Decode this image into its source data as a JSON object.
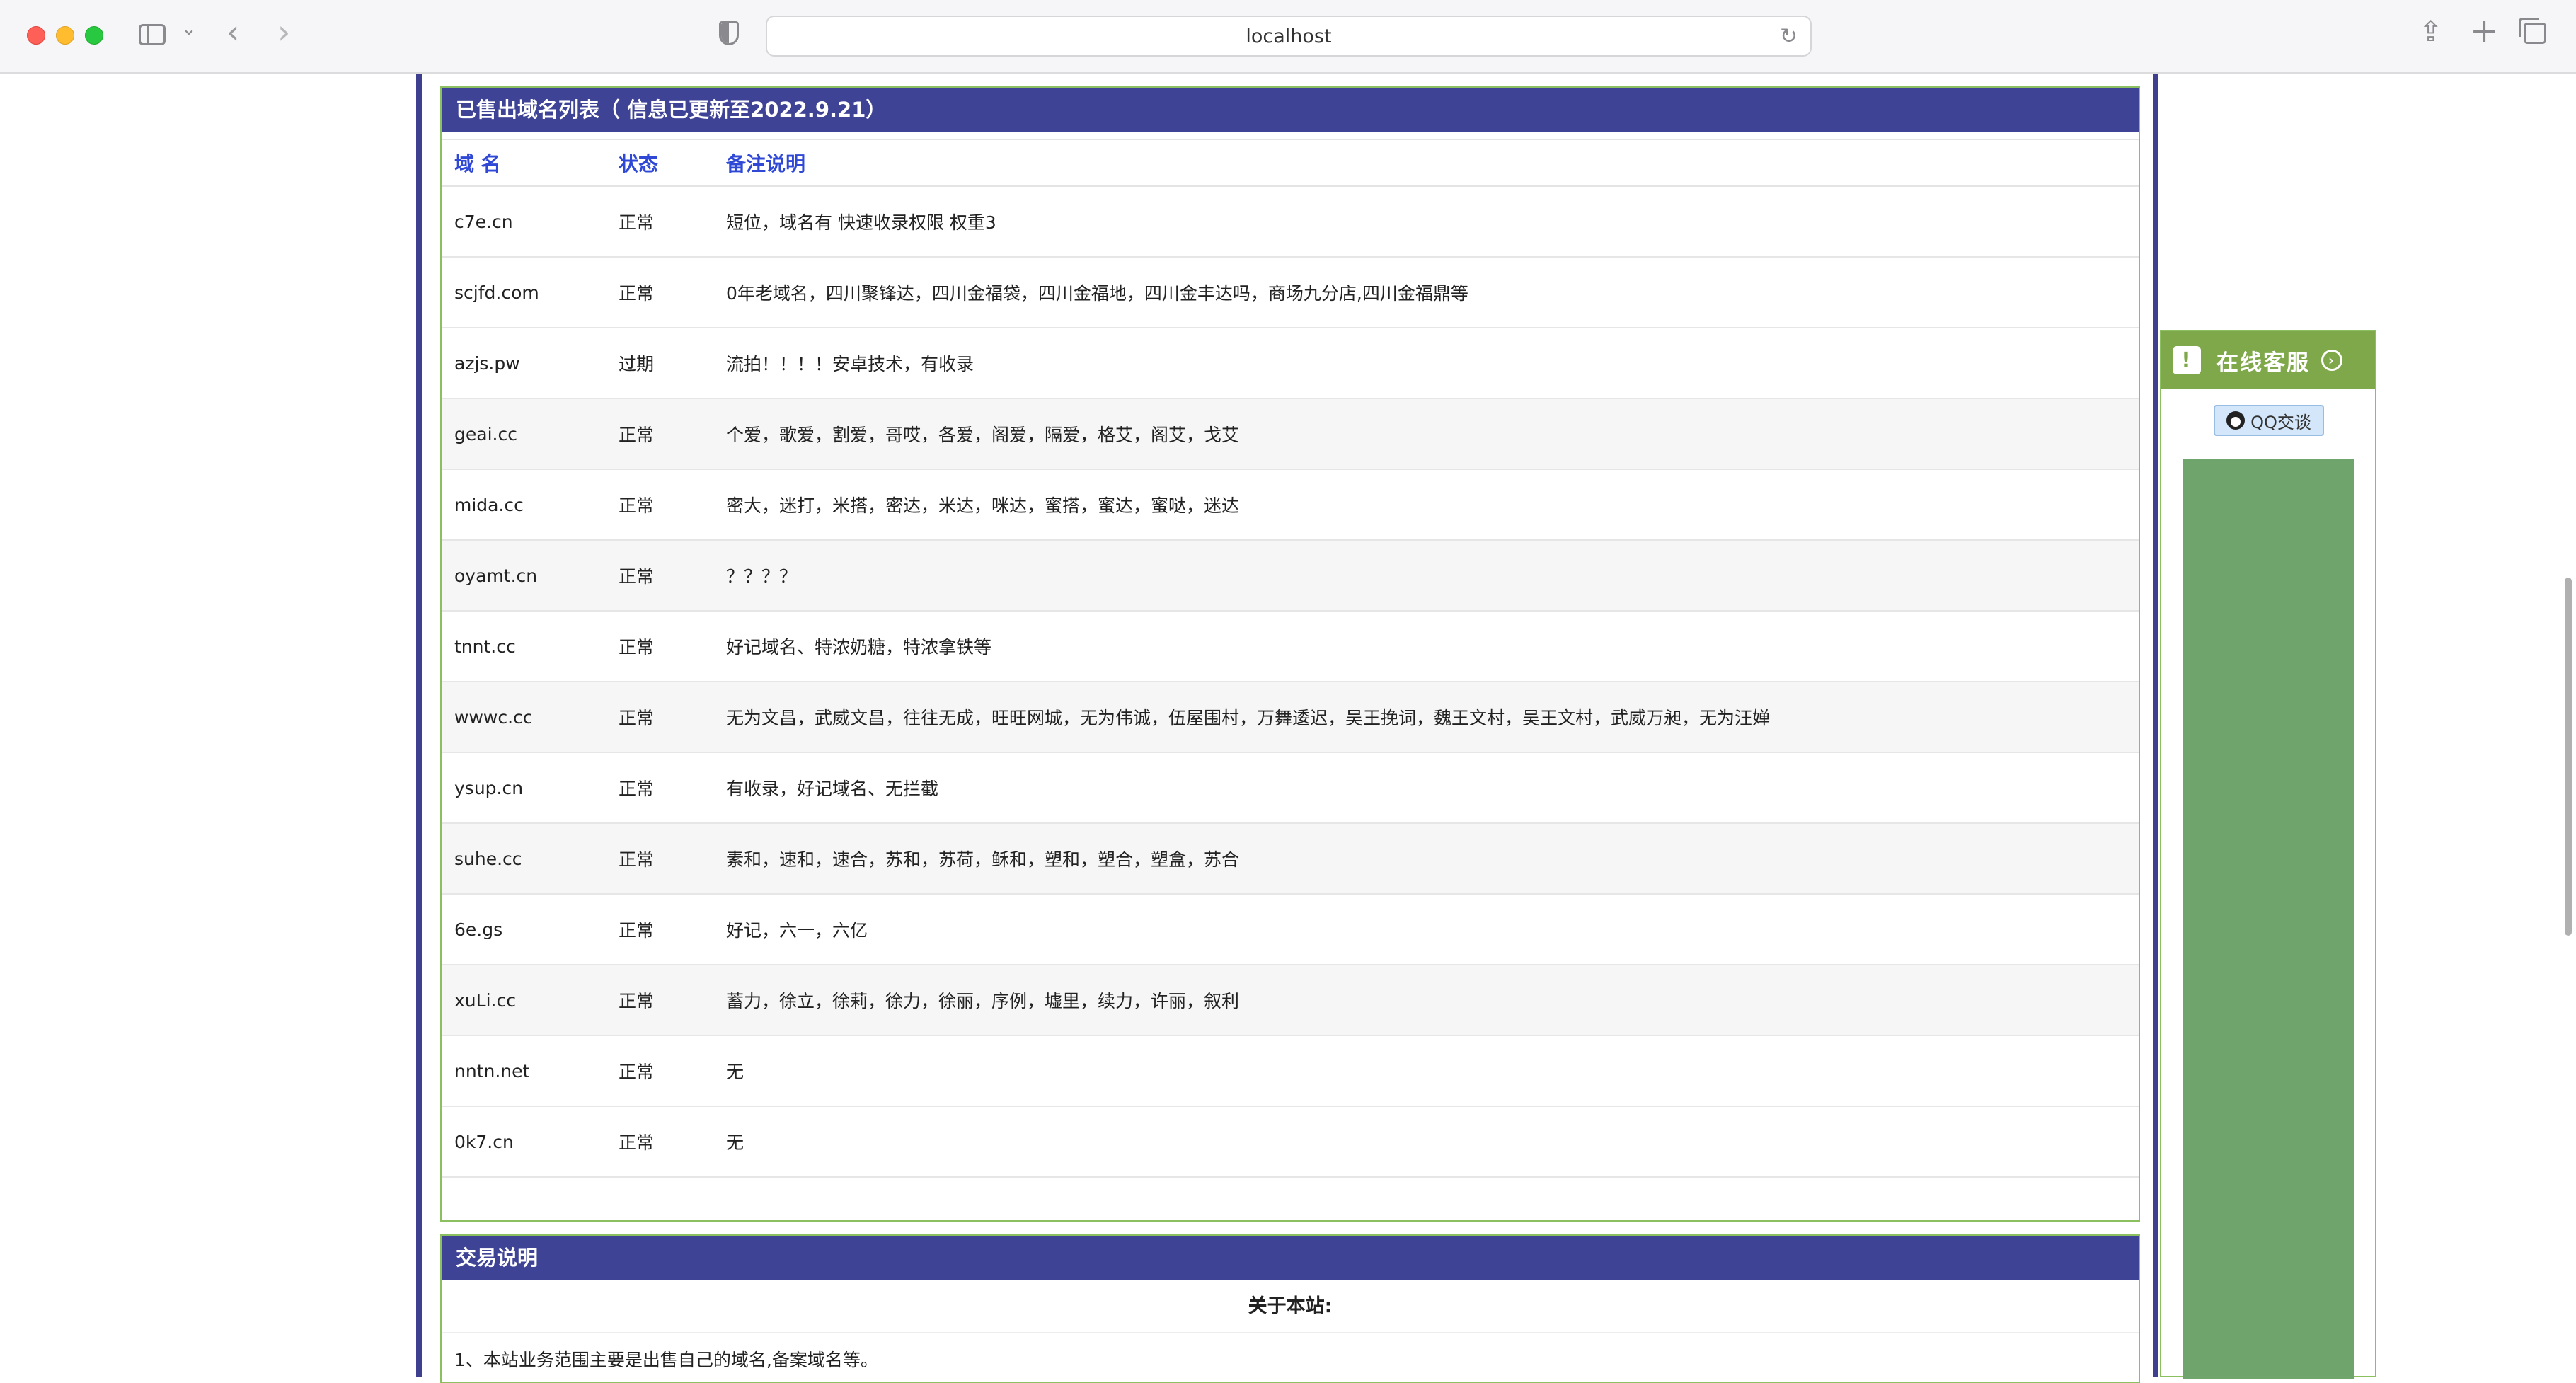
{
  "browser": {
    "url": "localhost"
  },
  "sold_panel": {
    "title": "已售出域名列表（ 信息已更新至2022.9.21）",
    "headers": {
      "name": "域 名",
      "status": "状态",
      "note": "备注说明"
    },
    "rows": [
      {
        "name": "c7e.cn",
        "status": "正常",
        "note": "短位，域名有 快速收录权限 权重3"
      },
      {
        "name": "scjfd.com",
        "status": "正常",
        "note": "0年老域名，四川聚锋达，四川金福袋，四川金福地，四川金丰达吗，商场九分店,四川金福鼎等"
      },
      {
        "name": "azjs.pw",
        "status": "过期",
        "note": "流拍！！！！安卓技术，有收录"
      },
      {
        "name": "geai.cc",
        "status": "正常",
        "note": "个爱，歌爱，割爱，哥哎，各爱，阁爱，隔爱，格艾，阁艾，戈艾"
      },
      {
        "name": "mida.cc",
        "status": "正常",
        "note": "密大，迷打，米搭，密达，米达，咪达，蜜搭，蜜达，蜜哒，迷达"
      },
      {
        "name": "oyamt.cn",
        "status": "正常",
        "note": "？？？？"
      },
      {
        "name": "tnnt.cc",
        "status": "正常",
        "note": "好记域名、特浓奶糖，特浓拿铁等"
      },
      {
        "name": "wwwc.cc",
        "status": "正常",
        "note": "无为文昌，武威文昌，往往无成，旺旺网城，无为伟诚，伍屋围村，万舞逶迟，吴王挽词，魏王文村，吴王文村，武威万昶，无为汪婵"
      },
      {
        "name": "ysup.cn",
        "status": "正常",
        "note": "有收录，好记域名、无拦截"
      },
      {
        "name": "suhe.cc",
        "status": "正常",
        "note": "素和，速和，速合，苏和，苏荷，稣和，塑和，塑合，塑盒，苏合"
      },
      {
        "name": "6e.gs",
        "status": "正常",
        "note": "好记，六一，六亿"
      },
      {
        "name": "xuLi.cc",
        "status": "正常",
        "note": "蓄力，徐立，徐莉，徐力，徐丽，序例，墟里，续力，许丽，叙利"
      },
      {
        "name": "nntn.net",
        "status": "正常",
        "note": "无"
      },
      {
        "name": "0k7.cn",
        "status": "正常",
        "note": "无"
      }
    ]
  },
  "trade_panel": {
    "title": "交易说明",
    "about_title": "关于本站:",
    "intro": "1、本站业务范围主要是出售自己的域名,备案域名等。"
  },
  "side_widget": {
    "title": "在线客服",
    "qq_label": "QQ交谈"
  },
  "colors": {
    "header_bg": "#3f4395",
    "link_blue": "#2f49d6",
    "green_border": "#8cbf5f",
    "side_green": "#7fa84a",
    "block_green": "#6fa56d"
  }
}
